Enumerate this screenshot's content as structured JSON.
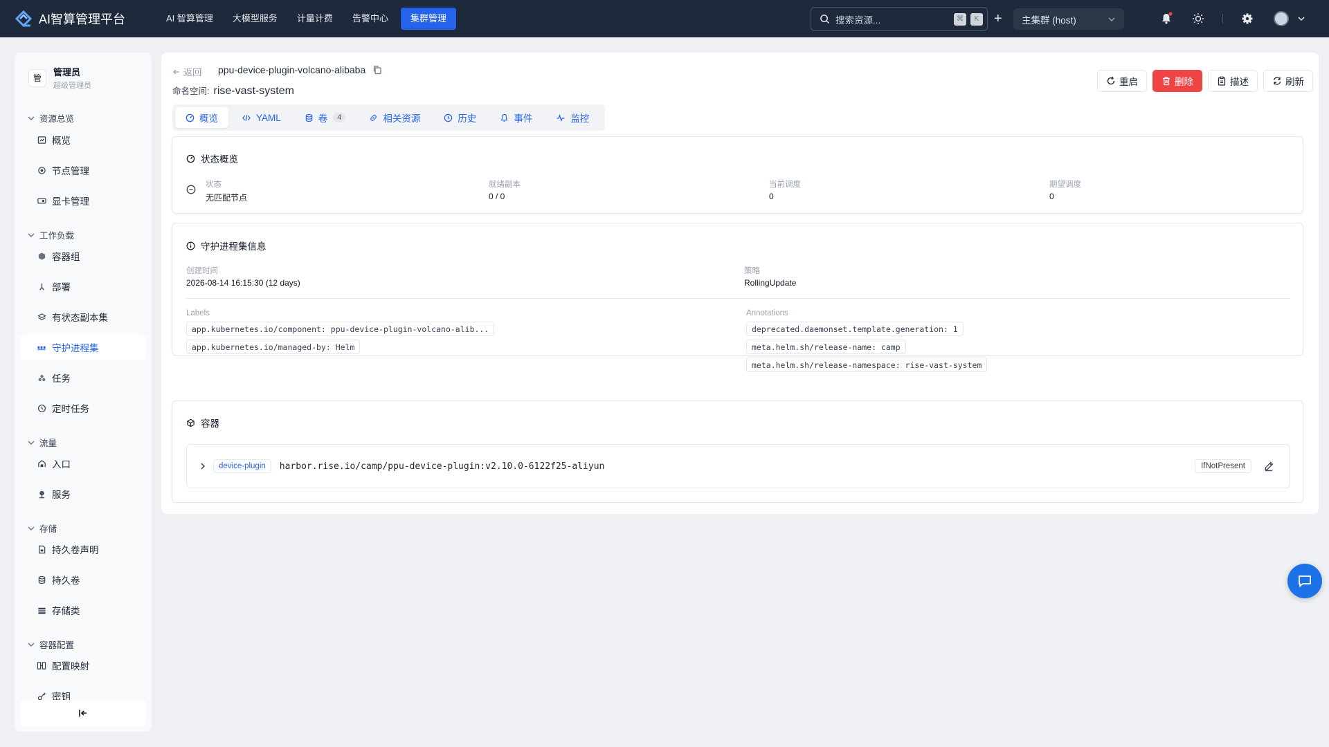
{
  "app": {
    "title": "AI智算管理平台"
  },
  "nav": {
    "items": [
      {
        "label": "AI 智算管理"
      },
      {
        "label": "大模型服务"
      },
      {
        "label": "计量计费"
      },
      {
        "label": "告警中心"
      },
      {
        "label": "集群管理",
        "active": true
      }
    ]
  },
  "search": {
    "placeholder": "搜索资源...",
    "kbd1": "⌘",
    "kbd2": "K"
  },
  "cluster": {
    "selected": "主集群 (host)"
  },
  "user": {
    "name": "管理员",
    "role": "超级管理员",
    "avatar_char": "管"
  },
  "sidebar": {
    "groups": [
      {
        "label": "资源总览"
      },
      {
        "label": "工作负载"
      },
      {
        "label": "流量"
      },
      {
        "label": "存储"
      },
      {
        "label": "容器配置"
      }
    ],
    "items": [
      {
        "label": "概览",
        "icon": "dashboard-icon"
      },
      {
        "label": "节点管理",
        "icon": "node-icon"
      },
      {
        "label": "显卡管理",
        "icon": "gpu-icon"
      },
      {
        "label": "容器组",
        "icon": "pod-icon"
      },
      {
        "label": "部署",
        "icon": "deploy-icon"
      },
      {
        "label": "有状态副本集",
        "icon": "layers-icon"
      },
      {
        "label": "守护进程集",
        "icon": "daemonset-icon",
        "active": true
      },
      {
        "label": "任务",
        "icon": "job-icon"
      },
      {
        "label": "定时任务",
        "icon": "clock-icon"
      },
      {
        "label": "入口",
        "icon": "ingress-icon"
      },
      {
        "label": "服务",
        "icon": "service-icon"
      },
      {
        "label": "持久卷声明",
        "icon": "pvc-icon"
      },
      {
        "label": "持久卷",
        "icon": "database-icon"
      },
      {
        "label": "存储类",
        "icon": "storage-class-icon"
      },
      {
        "label": "配置映射",
        "icon": "configmap-icon"
      },
      {
        "label": "密钥",
        "icon": "key-icon"
      }
    ]
  },
  "header": {
    "back_label": "返回",
    "resource_name": "ppu-device-plugin-volcano-alibaba",
    "namespace_label": "命名空间:",
    "namespace": "rise-vast-system"
  },
  "actions": {
    "restart": "重启",
    "delete": "删除",
    "describe": "描述",
    "refresh": "刷新"
  },
  "tabs": [
    {
      "label": "概览",
      "active": true
    },
    {
      "label": "YAML"
    },
    {
      "label": "卷",
      "count": "4"
    },
    {
      "label": "相关资源"
    },
    {
      "label": "历史"
    },
    {
      "label": "事件"
    },
    {
      "label": "监控"
    }
  ],
  "status": {
    "title": "状态概览",
    "fields": [
      {
        "label": "状态",
        "value": "无匹配节点"
      },
      {
        "label": "就绪副本",
        "value": "0 / 0"
      },
      {
        "label": "当前调度",
        "value": "0"
      },
      {
        "label": "期望调度",
        "value": "0"
      }
    ]
  },
  "info": {
    "title": "守护进程集信息",
    "created_label": "创建时间",
    "created_value": "2026-08-14 16:15:30 (12 days)",
    "strategy_label": "策略",
    "strategy_value": "RollingUpdate",
    "labels_title": "Labels",
    "labels": [
      "app.kubernetes.io/component: ppu-device-plugin-volcano-alib...",
      "app.kubernetes.io/managed-by: Helm"
    ],
    "annotations_title": "Annotations",
    "annotations": [
      "deprecated.daemonset.template.generation: 1",
      "meta.helm.sh/release-name: camp",
      "meta.helm.sh/release-namespace: rise-vast-system"
    ]
  },
  "containers": {
    "title": "容器",
    "items": [
      {
        "name": "device-plugin",
        "image": "harbor.rise.io/camp/ppu-device-plugin:v2.10.0-6122f25-aliyun",
        "pull_policy": "IfNotPresent"
      }
    ]
  },
  "colors": {
    "topbar": "#1e2a3b",
    "accent": "#2563eb",
    "danger": "#ef4444",
    "chat": "#1d72e8"
  }
}
